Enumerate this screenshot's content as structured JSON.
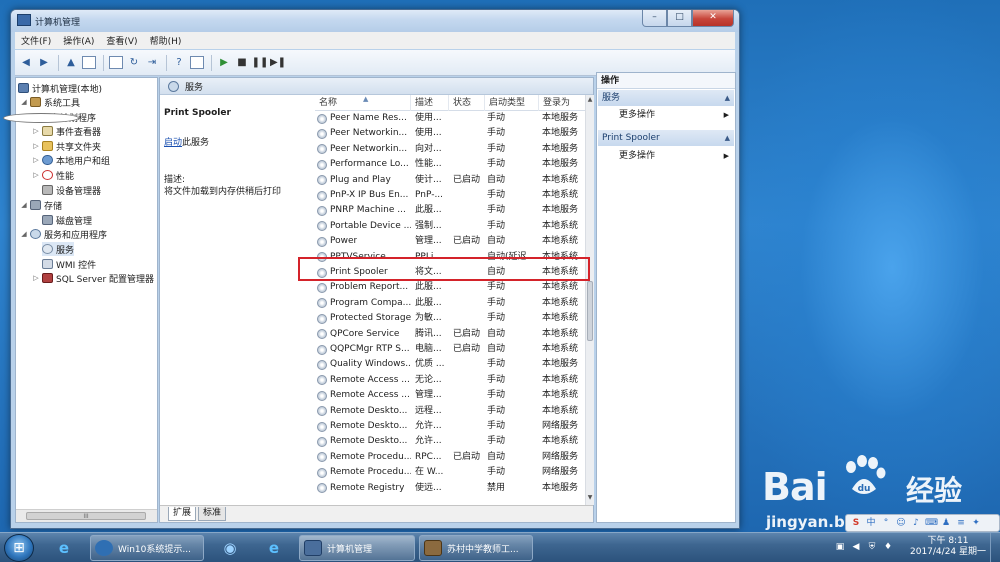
{
  "window": {
    "title": "计算机管理",
    "btn_min": "–",
    "btn_max": "□",
    "btn_close": "✕"
  },
  "menu": [
    "文件(F)",
    "操作(A)",
    "查看(V)",
    "帮助(H)"
  ],
  "tree": {
    "items": [
      {
        "label": "计算机管理(本地)",
        "icon": "computer-icon"
      },
      {
        "label": "系统工具",
        "icon": "tools-icon"
      },
      {
        "label": "任务计划程序",
        "icon": "clock-icon"
      },
      {
        "label": "事件查看器",
        "icon": "event-log-icon"
      },
      {
        "label": "共享文件夹",
        "icon": "folder-icon"
      },
      {
        "label": "本地用户和组",
        "icon": "users-icon"
      },
      {
        "label": "性能",
        "icon": "performance-icon"
      },
      {
        "label": "设备管理器",
        "icon": "device-icon"
      },
      {
        "label": "存储",
        "icon": "storage-icon"
      },
      {
        "label": "磁盘管理",
        "icon": "disk-icon"
      },
      {
        "label": "服务和应用程序",
        "icon": "services-apps-icon"
      },
      {
        "label": "服务",
        "icon": "services-icon"
      },
      {
        "label": "WMI 控件",
        "icon": "wmi-icon"
      },
      {
        "label": "SQL Server 配置管理器",
        "icon": "sql-icon"
      }
    ],
    "scroll_label": "III"
  },
  "center": {
    "header_title": "服务",
    "selected_service": "Print Spooler",
    "start_link": "启动",
    "start_suffix": "此服务",
    "desc_label": "描述:",
    "desc_text": "将文件加载到内存供稍后打印",
    "columns": [
      "名称",
      "描述",
      "状态",
      "启动类型",
      "登录为"
    ],
    "sort_indicator": "▲",
    "rows": [
      {
        "name": "Peer Name Res...",
        "desc": "使用...",
        "status": "",
        "start": "手动",
        "logon": "本地服务"
      },
      {
        "name": "Peer Networkin...",
        "desc": "使用...",
        "status": "",
        "start": "手动",
        "logon": "本地服务"
      },
      {
        "name": "Peer Networkin...",
        "desc": "向对...",
        "status": "",
        "start": "手动",
        "logon": "本地服务"
      },
      {
        "name": "Performance Lo...",
        "desc": "性能...",
        "status": "",
        "start": "手动",
        "logon": "本地服务"
      },
      {
        "name": "Plug and Play",
        "desc": "使计...",
        "status": "已启动",
        "start": "自动",
        "logon": "本地系统"
      },
      {
        "name": "PnP-X IP Bus En...",
        "desc": "PnP-...",
        "status": "",
        "start": "手动",
        "logon": "本地系统"
      },
      {
        "name": "PNRP Machine ...",
        "desc": "此服...",
        "status": "",
        "start": "手动",
        "logon": "本地服务"
      },
      {
        "name": "Portable Device ...",
        "desc": "强制...",
        "status": "",
        "start": "手动",
        "logon": "本地系统"
      },
      {
        "name": "Power",
        "desc": "管理...",
        "status": "已启动",
        "start": "自动",
        "logon": "本地系统"
      },
      {
        "name": "PPTVService",
        "desc": "PPLi...",
        "status": "",
        "start": "自动(延迟...",
        "logon": "本地系统"
      },
      {
        "name": "Print Spooler",
        "desc": "将文...",
        "status": "",
        "start": "自动",
        "logon": "本地系统"
      },
      {
        "name": "Problem Report...",
        "desc": "此服...",
        "status": "",
        "start": "手动",
        "logon": "本地系统"
      },
      {
        "name": "Program Compa...",
        "desc": "此服...",
        "status": "",
        "start": "手动",
        "logon": "本地系统"
      },
      {
        "name": "Protected Storage",
        "desc": "为敏...",
        "status": "",
        "start": "手动",
        "logon": "本地系统"
      },
      {
        "name": "QPCore Service",
        "desc": "腾讯...",
        "status": "已启动",
        "start": "自动",
        "logon": "本地系统"
      },
      {
        "name": "QQPCMgr RTP S...",
        "desc": "电脑...",
        "status": "已启动",
        "start": "自动",
        "logon": "本地系统"
      },
      {
        "name": "Quality Windows...",
        "desc": "优质 ...",
        "status": "",
        "start": "手动",
        "logon": "本地服务"
      },
      {
        "name": "Remote Access ...",
        "desc": "无论...",
        "status": "",
        "start": "手动",
        "logon": "本地系统"
      },
      {
        "name": "Remote Access ...",
        "desc": "管理...",
        "status": "",
        "start": "手动",
        "logon": "本地系统"
      },
      {
        "name": "Remote Deskto...",
        "desc": "远程...",
        "status": "",
        "start": "手动",
        "logon": "本地系统"
      },
      {
        "name": "Remote Deskto...",
        "desc": "允许...",
        "status": "",
        "start": "手动",
        "logon": "网络服务"
      },
      {
        "name": "Remote Deskto...",
        "desc": "允许...",
        "status": "",
        "start": "手动",
        "logon": "本地系统"
      },
      {
        "name": "Remote Procedu...",
        "desc": "RPC...",
        "status": "已启动",
        "start": "自动",
        "logon": "网络服务"
      },
      {
        "name": "Remote Procedu...",
        "desc": "在 W...",
        "status": "",
        "start": "手动",
        "logon": "网络服务"
      },
      {
        "name": "Remote Registry",
        "desc": "使远...",
        "status": "",
        "start": "禁用",
        "logon": "本地服务"
      }
    ],
    "tabs": [
      "扩展",
      "标准"
    ]
  },
  "actions": {
    "title": "操作",
    "sections": [
      {
        "label": "服务",
        "item": "更多操作"
      },
      {
        "label": "Print Spooler",
        "item": "更多操作"
      }
    ]
  },
  "taskbar": {
    "start_glyph": "⊞",
    "tasks": [
      "Win10系统提示...",
      "计算机管理",
      "苏村中学教师工..."
    ],
    "clock_time": "下午 8:11",
    "clock_date": "2017/4/24 星期一"
  },
  "watermark": {
    "brand": "Bai",
    "brand_cn": "经验",
    "url": "jingyan.baidu.com"
  },
  "colors": {
    "highlight_box": "#d4232a",
    "link": "#1a4fb0"
  }
}
